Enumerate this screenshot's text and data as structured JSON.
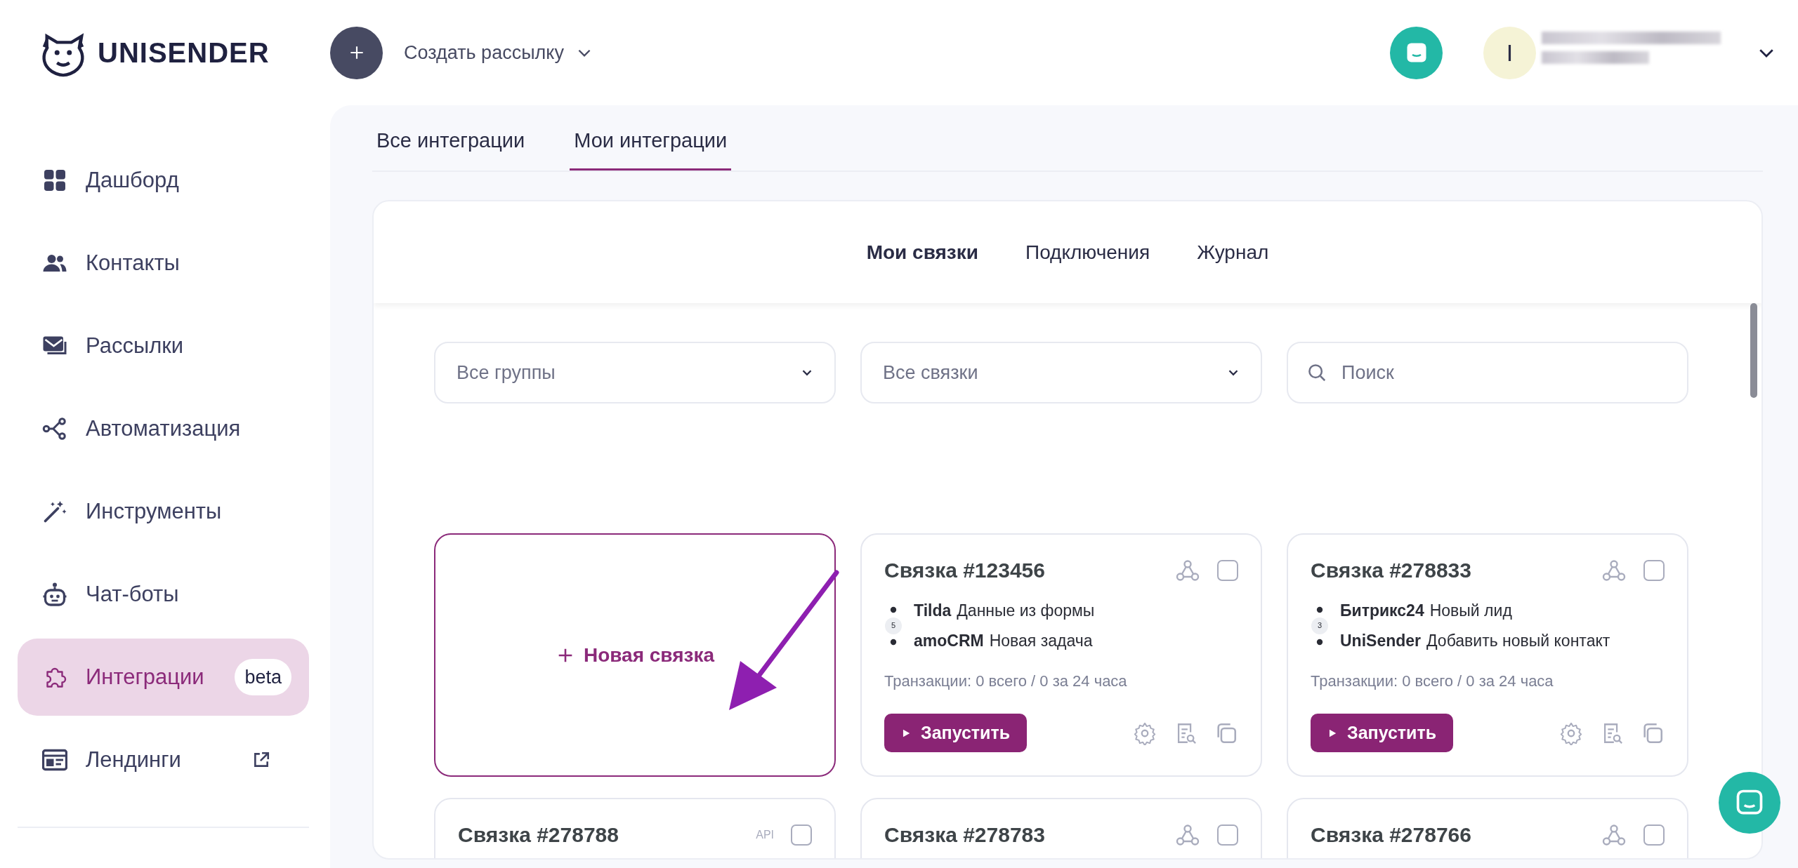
{
  "brand": {
    "name": "UNISENDER"
  },
  "header": {
    "create_label": "Создать рассылку",
    "avatar_letter": "I"
  },
  "sidebar": {
    "items": [
      {
        "label": "Дашборд",
        "selected": false
      },
      {
        "label": "Контакты",
        "selected": false
      },
      {
        "label": "Рассылки",
        "selected": false
      },
      {
        "label": "Автоматизация",
        "selected": false
      },
      {
        "label": "Инструменты",
        "selected": false
      },
      {
        "label": "Чат-боты",
        "selected": false
      },
      {
        "label": "Интеграции",
        "selected": true,
        "badge": "beta"
      },
      {
        "label": "Лендинги",
        "selected": false,
        "external": true
      }
    ]
  },
  "tabs": [
    {
      "label": "Все интеграции",
      "selected": false
    },
    {
      "label": "Мои интеграции",
      "selected": true
    }
  ],
  "subtabs": [
    {
      "label": "Мои связки",
      "selected": true
    },
    {
      "label": "Подключения",
      "selected": false
    },
    {
      "label": "Журнал",
      "selected": false
    }
  ],
  "filters": [
    {
      "kind": "select",
      "placeholder": "Все группы"
    },
    {
      "kind": "select",
      "placeholder": "Все связки"
    },
    {
      "kind": "search",
      "placeholder": "Поиск"
    }
  ],
  "cards": [
    {
      "kind": "new",
      "label": "Новая связка"
    },
    {
      "kind": "webhook",
      "title": "Связка #123456",
      "checked": false,
      "step_count": "5",
      "steps": [
        {
          "app": "Tilda",
          "action": "Данные из формы"
        },
        {
          "app": "amoCRM",
          "action": "Новая задача"
        }
      ],
      "transactions": "Транзакции: 0 всего / 0 за 24 часа",
      "run_label": "Запустить"
    },
    {
      "kind": "webhook",
      "title": "Связка #278833",
      "checked": false,
      "step_count": "3",
      "steps": [
        {
          "app": "Битрикс24",
          "action": "Новый лид"
        },
        {
          "app": "UniSender",
          "action": "Добавить новый контакт"
        }
      ],
      "transactions": "Транзакции: 0 всего / 0 за 24 часа",
      "run_label": "Запустить"
    },
    {
      "kind": "api",
      "title": "Связка #278788",
      "source_label": "API",
      "checked": false
    },
    {
      "kind": "webhook",
      "title": "Связка #278783",
      "checked": false
    },
    {
      "kind": "webhook",
      "title": "Связка #278766",
      "checked": false
    }
  ]
}
